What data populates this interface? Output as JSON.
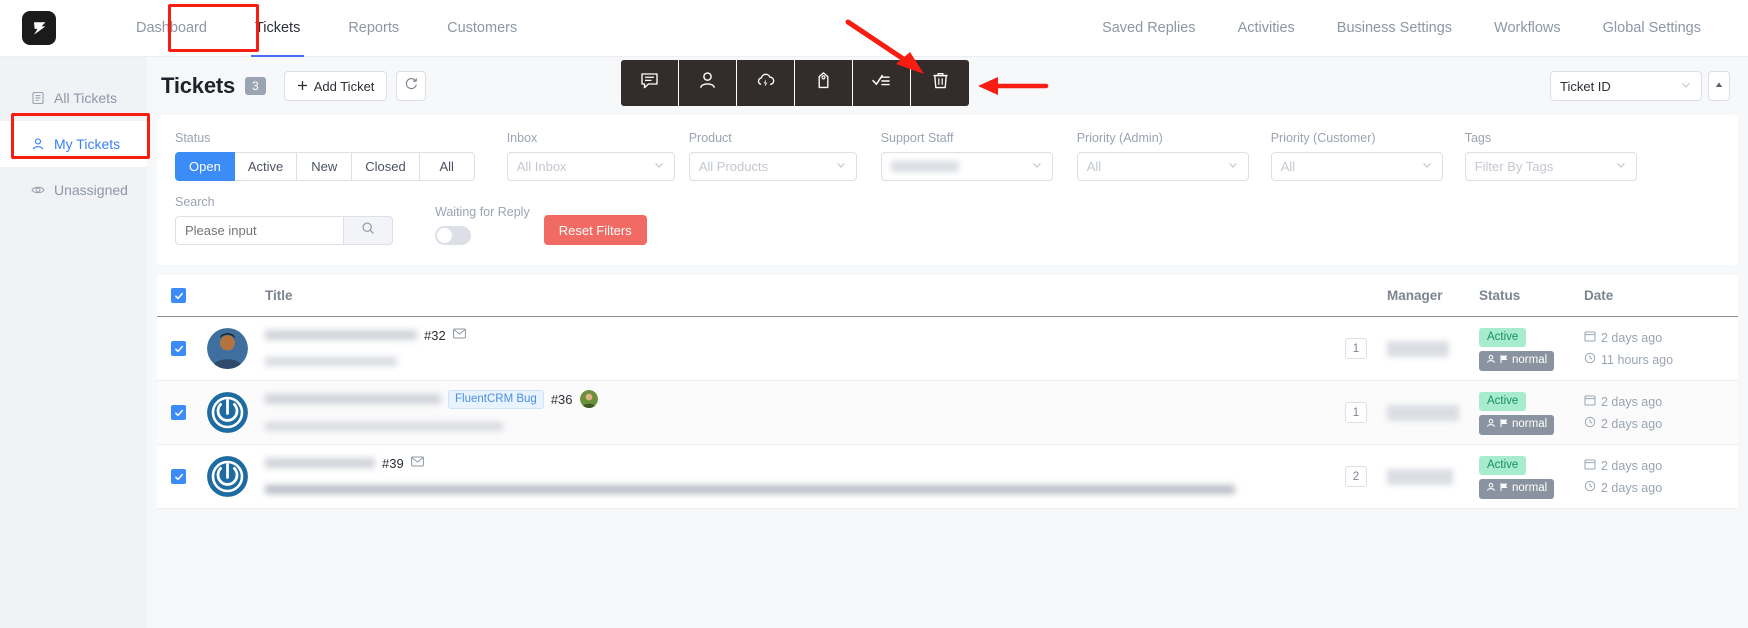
{
  "nav": {
    "logo_icon": "fluent-support-logo-icon",
    "left_items": [
      {
        "label": "Dashboard",
        "active": false
      },
      {
        "label": "Tickets",
        "active": true
      },
      {
        "label": "Reports",
        "active": false
      },
      {
        "label": "Customers",
        "active": false
      }
    ],
    "right_items": [
      {
        "label": "Saved Replies"
      },
      {
        "label": "Activities"
      },
      {
        "label": "Business Settings"
      },
      {
        "label": "Workflows"
      },
      {
        "label": "Global Settings"
      }
    ]
  },
  "sidebar": {
    "items": [
      {
        "label": "All Tickets",
        "icon": "document-list-icon",
        "active": false
      },
      {
        "label": "My Tickets",
        "icon": "user-icon",
        "active": true
      },
      {
        "label": "Unassigned",
        "icon": "eye-icon",
        "active": false
      }
    ]
  },
  "page": {
    "title": "Tickets",
    "count": "3",
    "add_button": "Add Ticket",
    "add_icon": "plus-icon",
    "refresh_icon": "refresh-icon"
  },
  "bulk_toolbar": {
    "buttons": [
      {
        "icon": "chat-message-icon",
        "name": "bulk-reply"
      },
      {
        "icon": "person-icon",
        "name": "bulk-assign-agent"
      },
      {
        "icon": "cloud-lightning-icon",
        "name": "bulk-cloud-action"
      },
      {
        "icon": "tag-icon",
        "name": "bulk-tag"
      },
      {
        "icon": "checklist-icon",
        "name": "bulk-status"
      },
      {
        "icon": "trash-icon",
        "name": "bulk-delete"
      }
    ]
  },
  "sorter": {
    "selected": "Ticket ID",
    "chevron_icon": "chevron-down-icon",
    "direction_icon": "sort-ascending-icon"
  },
  "filters": {
    "status": {
      "label": "Status",
      "options": [
        "Open",
        "Active",
        "New",
        "Closed",
        "All"
      ],
      "selected": "Open"
    },
    "inbox": {
      "label": "Inbox",
      "value": "All Inbox"
    },
    "product": {
      "label": "Product",
      "value": "All Products"
    },
    "support_staff": {
      "label": "Support Staff",
      "value": ""
    },
    "priority_admin": {
      "label": "Priority (Admin)",
      "value": "All"
    },
    "priority_customer": {
      "label": "Priority (Customer)",
      "value": "All"
    },
    "tags": {
      "label": "Tags",
      "value": "Filter By Tags"
    },
    "search": {
      "label": "Search",
      "placeholder": "Please input",
      "value": "",
      "icon": "search-icon"
    },
    "waiting_for_reply": {
      "label": "Waiting for Reply",
      "on": false
    },
    "reset_button": "Reset Filters"
  },
  "table": {
    "headers": {
      "title": "Title",
      "manager": "Manager",
      "status": "Status",
      "date": "Date"
    },
    "select_all_checked": true,
    "rows": [
      {
        "checked": true,
        "avatar": "photo-avatar",
        "ticket_id": "#32",
        "envelope_icon": "envelope-icon",
        "tag": "",
        "reply_count": "1",
        "status": "Active",
        "priority": "normal",
        "date_created": "2 days ago",
        "date_updated": "11 hours ago",
        "created_icon": "calendar-icon",
        "updated_icon": "clock-icon"
      },
      {
        "checked": true,
        "avatar": "wordpress-avatar",
        "ticket_id": "#36",
        "envelope_icon": "",
        "tag": "FluentCRM Bug",
        "reply_count": "1",
        "status": "Active",
        "priority": "normal",
        "date_created": "2 days ago",
        "date_updated": "2 days ago",
        "created_icon": "calendar-icon",
        "updated_icon": "clock-icon"
      },
      {
        "checked": true,
        "avatar": "wordpress-avatar",
        "ticket_id": "#39",
        "envelope_icon": "envelope-icon",
        "tag": "",
        "reply_count": "2",
        "status": "Active",
        "priority": "normal",
        "date_created": "2 days ago",
        "date_updated": "2 days ago",
        "created_icon": "calendar-icon",
        "updated_icon": "clock-icon"
      }
    ]
  },
  "annotations": {
    "accent_color": "#f81d12",
    "boxes": [
      "tickets-tab",
      "my-tickets-sidebar"
    ],
    "arrows": [
      "arrow-to-checklist-button",
      "arrow-to-delete-button"
    ]
  }
}
